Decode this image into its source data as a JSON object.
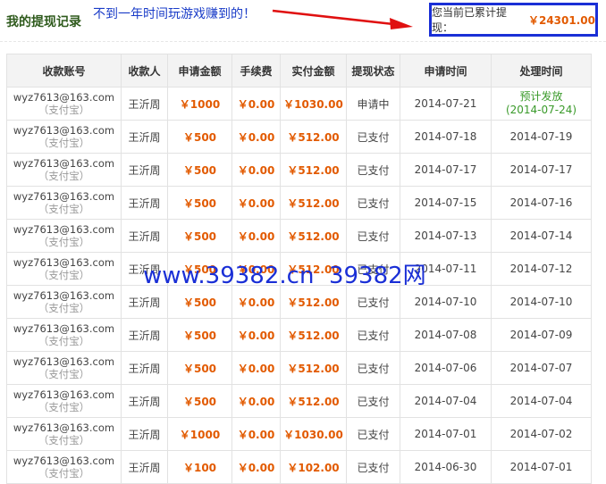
{
  "page_title": "我的提现记录",
  "annotation": "不到一年时间玩游戏赚到的！",
  "total": {
    "label": "您当前已累计提现：",
    "amount": "￥24301.00"
  },
  "watermark": "www.39382.cn  39382网",
  "colors": {
    "accent": "#e25a00",
    "annotation_blue": "#1a2fd6",
    "arrow_red": "#e01010",
    "pending_green": "#3a9a2a"
  },
  "table": {
    "headers": [
      "收款账号",
      "收款人",
      "申请金额",
      "手续费",
      "实付金额",
      "提现状态",
      "申请时间",
      "处理时间"
    ],
    "rows": [
      {
        "account": "wyz7613@163.com",
        "method": "（支付宝）",
        "payee": "王沂周",
        "amount": "￥1000",
        "fee": "￥0.00",
        "paid": "￥1030.00",
        "status": "申请中",
        "apply": "2014-07-21",
        "process": "预计发放",
        "process_sub": "(2014-07-24)"
      },
      {
        "account": "wyz7613@163.com",
        "method": "（支付宝）",
        "payee": "王沂周",
        "amount": "￥500",
        "fee": "￥0.00",
        "paid": "￥512.00",
        "status": "已支付",
        "apply": "2014-07-18",
        "process": "2014-07-19"
      },
      {
        "account": "wyz7613@163.com",
        "method": "（支付宝）",
        "payee": "王沂周",
        "amount": "￥500",
        "fee": "￥0.00",
        "paid": "￥512.00",
        "status": "已支付",
        "apply": "2014-07-17",
        "process": "2014-07-17"
      },
      {
        "account": "wyz7613@163.com",
        "method": "（支付宝）",
        "payee": "王沂周",
        "amount": "￥500",
        "fee": "￥0.00",
        "paid": "￥512.00",
        "status": "已支付",
        "apply": "2014-07-15",
        "process": "2014-07-16"
      },
      {
        "account": "wyz7613@163.com",
        "method": "（支付宝）",
        "payee": "王沂周",
        "amount": "￥500",
        "fee": "￥0.00",
        "paid": "￥512.00",
        "status": "已支付",
        "apply": "2014-07-13",
        "process": "2014-07-14"
      },
      {
        "account": "wyz7613@163.com",
        "method": "（支付宝）",
        "payee": "王沂周",
        "amount": "￥500",
        "fee": "￥0.00",
        "paid": "￥512.00",
        "status": "已支付",
        "apply": "2014-07-11",
        "process": "2014-07-12"
      },
      {
        "account": "wyz7613@163.com",
        "method": "（支付宝）",
        "payee": "王沂周",
        "amount": "￥500",
        "fee": "￥0.00",
        "paid": "￥512.00",
        "status": "已支付",
        "apply": "2014-07-10",
        "process": "2014-07-10"
      },
      {
        "account": "wyz7613@163.com",
        "method": "（支付宝）",
        "payee": "王沂周",
        "amount": "￥500",
        "fee": "￥0.00",
        "paid": "￥512.00",
        "status": "已支付",
        "apply": "2014-07-08",
        "process": "2014-07-09"
      },
      {
        "account": "wyz7613@163.com",
        "method": "（支付宝）",
        "payee": "王沂周",
        "amount": "￥500",
        "fee": "￥0.00",
        "paid": "￥512.00",
        "status": "已支付",
        "apply": "2014-07-06",
        "process": "2014-07-07"
      },
      {
        "account": "wyz7613@163.com",
        "method": "（支付宝）",
        "payee": "王沂周",
        "amount": "￥500",
        "fee": "￥0.00",
        "paid": "￥512.00",
        "status": "已支付",
        "apply": "2014-07-04",
        "process": "2014-07-04"
      },
      {
        "account": "wyz7613@163.com",
        "method": "（支付宝）",
        "payee": "王沂周",
        "amount": "￥1000",
        "fee": "￥0.00",
        "paid": "￥1030.00",
        "status": "已支付",
        "apply": "2014-07-01",
        "process": "2014-07-02"
      },
      {
        "account": "wyz7613@163.com",
        "method": "（支付宝）",
        "payee": "王沂周",
        "amount": "￥100",
        "fee": "￥0.00",
        "paid": "￥102.00",
        "status": "已支付",
        "apply": "2014-06-30",
        "process": "2014-07-01"
      }
    ]
  }
}
